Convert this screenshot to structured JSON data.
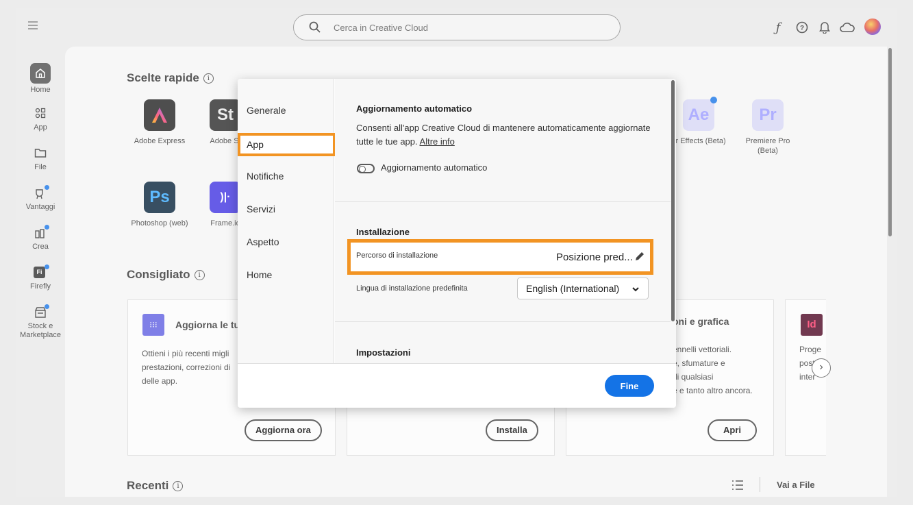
{
  "topbar": {
    "search_placeholder": "Cerca in Creative Cloud",
    "icons": [
      "menu-icon",
      "search-icon",
      "fonts-icon",
      "help-icon",
      "notifications-icon",
      "cloud-icon",
      "avatar"
    ]
  },
  "sidebar": {
    "items": [
      {
        "label": "Home",
        "icon": "home-icon"
      },
      {
        "label": "App",
        "icon": "apps-icon"
      },
      {
        "label": "File",
        "icon": "folder-icon"
      },
      {
        "label": "Vantaggi",
        "icon": "rewards-icon"
      },
      {
        "label": "Crea",
        "icon": "create-icon"
      },
      {
        "label": "Firefly",
        "icon": "firefly-icon"
      },
      {
        "label": "Stock e Marketplace",
        "icon": "stock-icon"
      }
    ]
  },
  "main": {
    "quick_title": "Scelte rapide",
    "apps": [
      {
        "name": "Adobe Express",
        "abbr": "A",
        "bg": "#1d1d1d",
        "fg": "#ff4f64"
      },
      {
        "name": "Adobe St",
        "abbr": "St",
        "bg": "#262626",
        "fg": "#e8e8e8"
      },
      {
        "name": "Photoshop (web)",
        "abbr": "Ps",
        "bg": "#001e36",
        "fg": "#31a8ff"
      },
      {
        "name": "Frame.io",
        "abbr": ")|·",
        "bg": "#3b2fe0",
        "fg": "#ffffff"
      },
      {
        "name": "er Effects (Beta)",
        "abbr": "Ae",
        "bg": "#d6d6f5",
        "fg": "#9999ff"
      },
      {
        "name": "Premiere Pro (Beta)",
        "abbr": "Pr",
        "bg": "#d6d6f5",
        "fg": "#9999ff"
      }
    ],
    "recommended_title": "Consigliato",
    "cards": [
      {
        "title": "Aggiorna le tu",
        "text": [
          "Ottieni i più recenti migli",
          "prestazioni, correzioni di",
          "delle app."
        ],
        "button": "Aggiorna ora"
      },
      {
        "button": "Installa"
      },
      {
        "title": "oni e grafica",
        "text": [
          "ennelli vettoriali.",
          "e, sfumature e",
          "di qualsiasi",
          "e e tanto altro ancora."
        ],
        "button": "Apri"
      },
      {
        "text": [
          "Proge",
          "posts",
          "inter"
        ]
      }
    ],
    "recent_title": "Recenti",
    "goto_files": "Vai a File"
  },
  "modal": {
    "nav": [
      "Generale",
      "App",
      "Notifiche",
      "Servizi",
      "Aspetto",
      "Home"
    ],
    "active": "App",
    "auto_update": {
      "title": "Aggiornamento automatico",
      "desc_line1": "Consenti all'app Creative Cloud di mantenere automaticamente aggiornate",
      "desc_line2": "tutte le tue app.",
      "link": "Altre info",
      "toggle_label": "Aggiornamento automatico"
    },
    "install": {
      "title": "Installazione",
      "path_label": "Percorso di installazione",
      "path_value": "Posizione pred...",
      "lang_label": "Lingua di installazione predefinita",
      "lang_value": "English (International)"
    },
    "settings_title": "Impostazioni",
    "done": "Fine"
  }
}
